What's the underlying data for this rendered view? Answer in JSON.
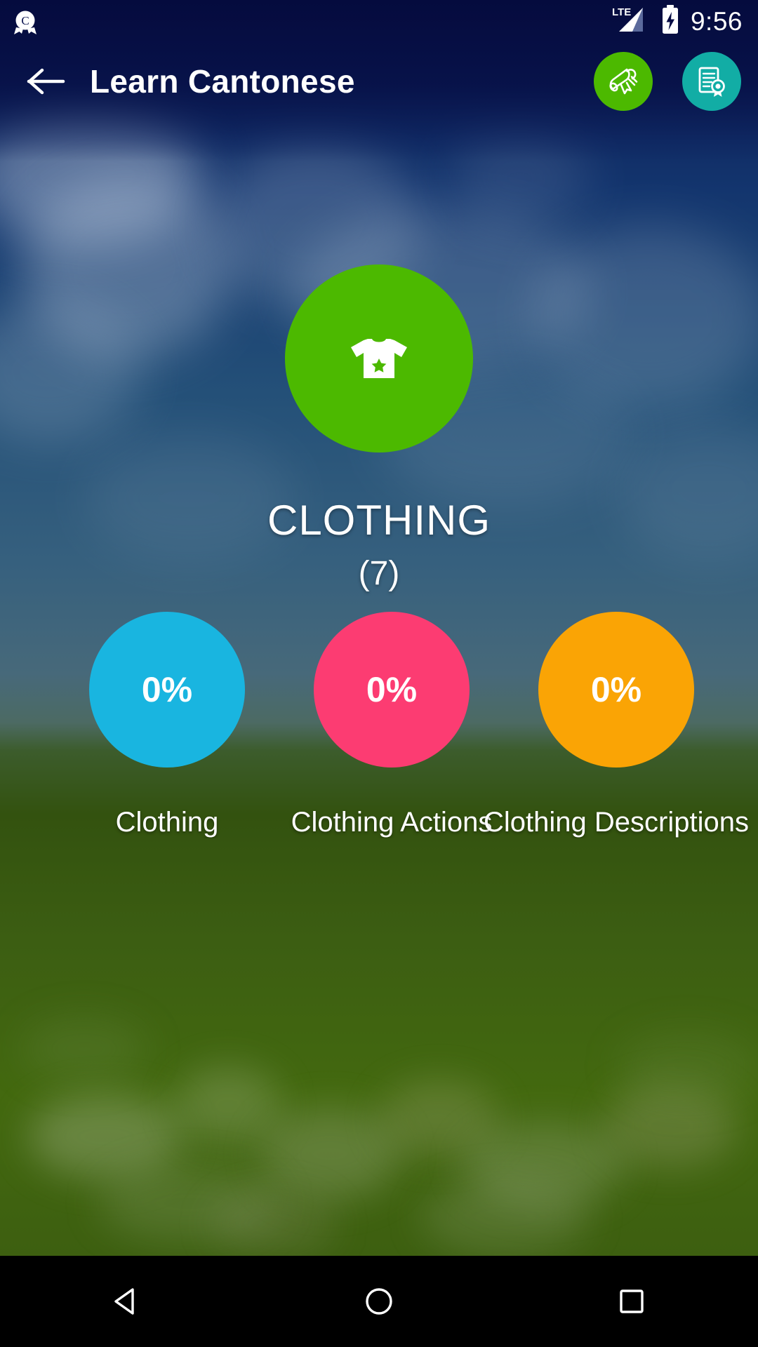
{
  "status_bar": {
    "notification_icon": "circle-badge-c-icon",
    "network_label": "LTE",
    "signal_icon": "signal-bars-icon",
    "battery_icon": "battery-charging-icon",
    "time": "9:56"
  },
  "app_bar": {
    "back_icon": "arrow-left-icon",
    "title": "Learn Cantonese",
    "actions": [
      {
        "name": "diploma-scroll-button",
        "icon": "scroll-diploma-icon",
        "color": "#4CB900"
      },
      {
        "name": "certificate-button",
        "icon": "certificate-award-icon",
        "color": "#12ADA5"
      }
    ]
  },
  "category": {
    "icon": "tshirt-star-icon",
    "icon_color": "#4CB900",
    "title": "CLOTHING",
    "count": "(7)"
  },
  "lessons": [
    {
      "percent": "0%",
      "label": "Clothing",
      "color": "#19B5E0"
    },
    {
      "percent": "0%",
      "label": "Clothing Actions",
      "color": "#FC3C72"
    },
    {
      "percent": "0%",
      "label": "Clothing Descriptions",
      "color": "#FAA405"
    }
  ],
  "nav_bar": {
    "back": "triangle-back-icon",
    "home": "circle-home-icon",
    "recents": "square-recents-icon"
  },
  "theme": {
    "status_bar_bg": "#060B44",
    "text_on_photo": "#FFFFFF",
    "nav_bar_bg": "#000000"
  }
}
